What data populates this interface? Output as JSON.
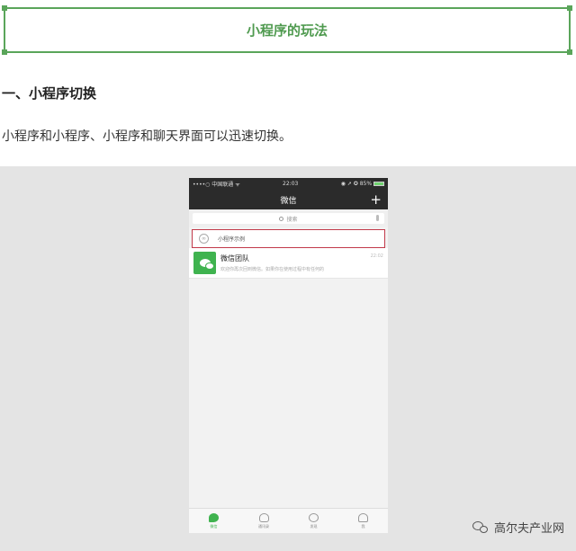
{
  "title": "小程序的玩法",
  "section": {
    "heading": "一、小程序切换",
    "text": "小程序和小程序、小程序和聊天界面可以迅速切换。"
  },
  "phone": {
    "status": {
      "carrier": "••••○ 中国联通 ᯤ",
      "time": "22:03",
      "right": "◉ ➚ ✪ 85%"
    },
    "nav_title": "微信",
    "nav_plus": "+",
    "search_placeholder": "搜索",
    "mini_program_label": "小程序示例",
    "chat": {
      "name": "微信团队",
      "preview": "欢迎你再次回到微信。如果你在使用过程中有任何的",
      "time": "22:02"
    },
    "tabs": [
      {
        "label": "微信",
        "icon": "chat-icon"
      },
      {
        "label": "通讯录",
        "icon": "contacts-icon"
      },
      {
        "label": "发现",
        "icon": "discover-icon"
      },
      {
        "label": "我",
        "icon": "me-icon"
      }
    ]
  },
  "watermark": "高尔夫产业网",
  "colors": {
    "title_green": "#4f9a4f",
    "wechat_green": "#3fb34f",
    "highlight_red": "#c23a4a"
  }
}
